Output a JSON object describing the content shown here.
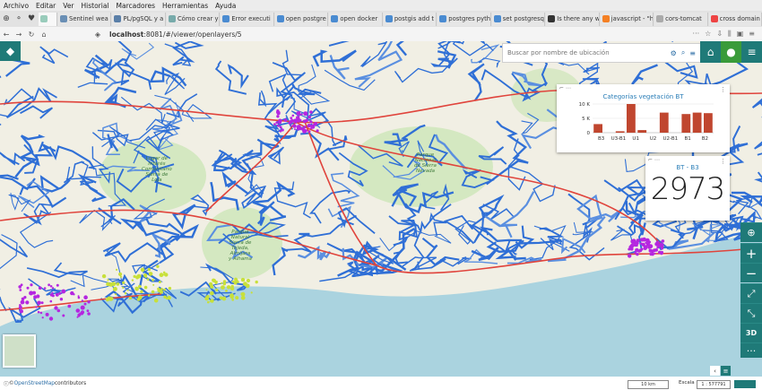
{
  "menu": [
    "Archivo",
    "Editar",
    "Ver",
    "Historial",
    "Marcadores",
    "Herramientas",
    "Ayuda"
  ],
  "tabs": [
    {
      "label": "Sentinel wea",
      "color": "#6a8fb5"
    },
    {
      "label": "PL/pgSQL y a",
      "color": "#5a7fa8"
    },
    {
      "label": "Cómo crear y",
      "color": "#7aa"
    },
    {
      "label": "Error executi",
      "color": "#4a8bd1"
    },
    {
      "label": "open postgre",
      "color": "#4a8bd1"
    },
    {
      "label": "open docker",
      "color": "#4a8bd1"
    },
    {
      "label": "postgis add t",
      "color": "#4a8bd1"
    },
    {
      "label": "postgres pyth",
      "color": "#4a8bd1"
    },
    {
      "label": "set postgresq",
      "color": "#4a8bd1"
    },
    {
      "label": "Is there any w",
      "color": "#333"
    },
    {
      "label": "javascript - \"h",
      "color": "#f48024"
    },
    {
      "label": "cors-tomcat",
      "color": "#aaa"
    },
    {
      "label": "cross domain",
      "color": "#e44"
    }
  ],
  "url": {
    "host": "localhost",
    "rest": ":8081/#/viewer/openlayers/5"
  },
  "search": {
    "placeholder": "Buscar por nombre de ubicación"
  },
  "chart_widget": {
    "title": "Categorías vegetación BT"
  },
  "number_widget": {
    "title": "BT - B3",
    "value": "2973"
  },
  "chart_data": {
    "type": "bar",
    "title": "Categorías vegetación BT",
    "categories": [
      "B3",
      "U3-B1",
      "U1",
      "U2",
      "U2-B1",
      "B1",
      "B2"
    ],
    "values": [
      3000,
      0,
      500,
      10000,
      900,
      0,
      7000,
      0,
      6500,
      7000,
      6800
    ],
    "ylim": [
      0,
      10000
    ],
    "yticks": [
      "0",
      "5 K",
      "10 K"
    ],
    "color": "#c0462f"
  },
  "attribution": {
    "prefix": "© ",
    "link": "OpenStreetMap",
    "suffix": " contributors"
  },
  "scale": {
    "bar_label": "10 km",
    "scale_label": "Escala",
    "ratio_prefix": "1 :",
    "ratio": "577791"
  },
  "map_labels": [
    {
      "text": "Lugar de\nInterés\nComunitario\nSierra de\nLoja"
    },
    {
      "text": "Parque\nNacional\nde Sierra\nNevada"
    },
    {
      "text": "Parque\nNatural\nSierra de\nTejeda,\nAlmijara\ny Alhama"
    }
  ]
}
